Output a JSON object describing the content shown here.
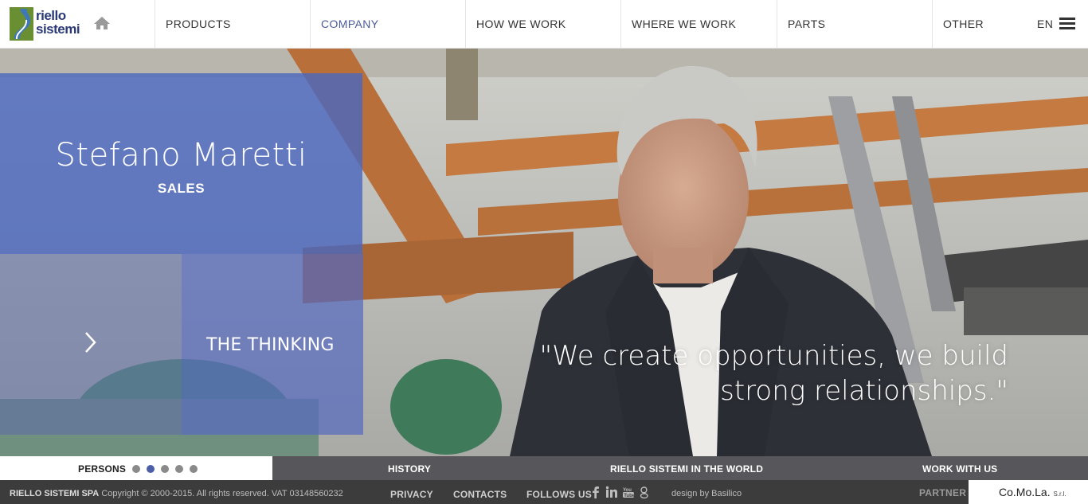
{
  "logo": {
    "line1": "riello",
    "line2": "sistemi"
  },
  "nav": {
    "items": [
      {
        "label": "PRODUCTS"
      },
      {
        "label": "COMPANY"
      },
      {
        "label": "HOW WE WORK"
      },
      {
        "label": "WHERE WE WORK"
      },
      {
        "label": "PARTS"
      },
      {
        "label": "OTHER"
      }
    ],
    "active_label": "COMPANY",
    "language": "EN"
  },
  "hero": {
    "person_name": "Stefano Maretti",
    "person_role": "SALES",
    "next_panel_label": "THE THINKING",
    "quote_line1": "\"We create opportunities, we build",
    "quote_line2": "strong relationships.\""
  },
  "tabs": {
    "persons_label": "PERSONS",
    "persons_dots": 5,
    "persons_active_dot": 2,
    "history_label": "HISTORY",
    "world_label": "RIELLO SISTEMI IN THE WORLD",
    "work_label": "WORK WITH US"
  },
  "footer": {
    "company": "RIELLO SISTEMI SPA",
    "copyright": "Copyright © 2000-2015. All rights reserved. VAT 03148560232",
    "privacy": "PRIVACY",
    "contacts": "CONTACTS",
    "follow": "FOLLOWS US",
    "design_prefix": "design by",
    "design_name": "Basilico",
    "partner_label": "PARTNER",
    "partner_name": "Co.Mo.La.",
    "partner_suffix": "S.r.l."
  },
  "colors": {
    "brand_blue": "#4c68be",
    "logo_green": "#6a8f32",
    "footer_bg": "#3c3c3c",
    "active_nav": "#4a5a98"
  },
  "icons": [
    "home-icon",
    "menu-icon",
    "chevron-right-icon",
    "facebook-icon",
    "linkedin-icon",
    "youtube-icon",
    "googleplus-icon"
  ]
}
